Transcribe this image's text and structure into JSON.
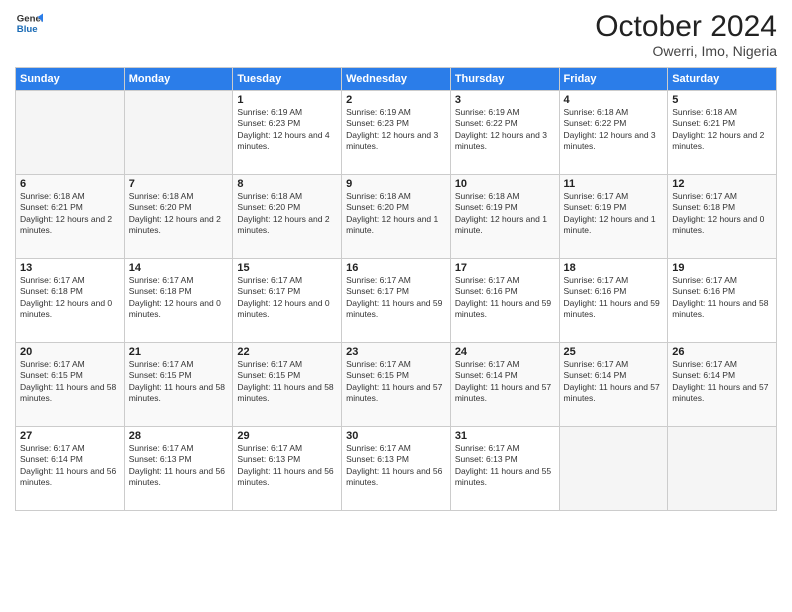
{
  "logo": {
    "line1": "General",
    "line2": "Blue"
  },
  "title": "October 2024",
  "location": "Owerri, Imo, Nigeria",
  "days_of_week": [
    "Sunday",
    "Monday",
    "Tuesday",
    "Wednesday",
    "Thursday",
    "Friday",
    "Saturday"
  ],
  "weeks": [
    [
      {
        "day": "",
        "info": ""
      },
      {
        "day": "",
        "info": ""
      },
      {
        "day": "1",
        "info": "Sunrise: 6:19 AM\nSunset: 6:23 PM\nDaylight: 12 hours and 4 minutes."
      },
      {
        "day": "2",
        "info": "Sunrise: 6:19 AM\nSunset: 6:23 PM\nDaylight: 12 hours and 3 minutes."
      },
      {
        "day": "3",
        "info": "Sunrise: 6:19 AM\nSunset: 6:22 PM\nDaylight: 12 hours and 3 minutes."
      },
      {
        "day": "4",
        "info": "Sunrise: 6:18 AM\nSunset: 6:22 PM\nDaylight: 12 hours and 3 minutes."
      },
      {
        "day": "5",
        "info": "Sunrise: 6:18 AM\nSunset: 6:21 PM\nDaylight: 12 hours and 2 minutes."
      }
    ],
    [
      {
        "day": "6",
        "info": "Sunrise: 6:18 AM\nSunset: 6:21 PM\nDaylight: 12 hours and 2 minutes."
      },
      {
        "day": "7",
        "info": "Sunrise: 6:18 AM\nSunset: 6:20 PM\nDaylight: 12 hours and 2 minutes."
      },
      {
        "day": "8",
        "info": "Sunrise: 6:18 AM\nSunset: 6:20 PM\nDaylight: 12 hours and 2 minutes."
      },
      {
        "day": "9",
        "info": "Sunrise: 6:18 AM\nSunset: 6:20 PM\nDaylight: 12 hours and 1 minute."
      },
      {
        "day": "10",
        "info": "Sunrise: 6:18 AM\nSunset: 6:19 PM\nDaylight: 12 hours and 1 minute."
      },
      {
        "day": "11",
        "info": "Sunrise: 6:17 AM\nSunset: 6:19 PM\nDaylight: 12 hours and 1 minute."
      },
      {
        "day": "12",
        "info": "Sunrise: 6:17 AM\nSunset: 6:18 PM\nDaylight: 12 hours and 0 minutes."
      }
    ],
    [
      {
        "day": "13",
        "info": "Sunrise: 6:17 AM\nSunset: 6:18 PM\nDaylight: 12 hours and 0 minutes."
      },
      {
        "day": "14",
        "info": "Sunrise: 6:17 AM\nSunset: 6:18 PM\nDaylight: 12 hours and 0 minutes."
      },
      {
        "day": "15",
        "info": "Sunrise: 6:17 AM\nSunset: 6:17 PM\nDaylight: 12 hours and 0 minutes."
      },
      {
        "day": "16",
        "info": "Sunrise: 6:17 AM\nSunset: 6:17 PM\nDaylight: 11 hours and 59 minutes."
      },
      {
        "day": "17",
        "info": "Sunrise: 6:17 AM\nSunset: 6:16 PM\nDaylight: 11 hours and 59 minutes."
      },
      {
        "day": "18",
        "info": "Sunrise: 6:17 AM\nSunset: 6:16 PM\nDaylight: 11 hours and 59 minutes."
      },
      {
        "day": "19",
        "info": "Sunrise: 6:17 AM\nSunset: 6:16 PM\nDaylight: 11 hours and 58 minutes."
      }
    ],
    [
      {
        "day": "20",
        "info": "Sunrise: 6:17 AM\nSunset: 6:15 PM\nDaylight: 11 hours and 58 minutes."
      },
      {
        "day": "21",
        "info": "Sunrise: 6:17 AM\nSunset: 6:15 PM\nDaylight: 11 hours and 58 minutes."
      },
      {
        "day": "22",
        "info": "Sunrise: 6:17 AM\nSunset: 6:15 PM\nDaylight: 11 hours and 58 minutes."
      },
      {
        "day": "23",
        "info": "Sunrise: 6:17 AM\nSunset: 6:15 PM\nDaylight: 11 hours and 57 minutes."
      },
      {
        "day": "24",
        "info": "Sunrise: 6:17 AM\nSunset: 6:14 PM\nDaylight: 11 hours and 57 minutes."
      },
      {
        "day": "25",
        "info": "Sunrise: 6:17 AM\nSunset: 6:14 PM\nDaylight: 11 hours and 57 minutes."
      },
      {
        "day": "26",
        "info": "Sunrise: 6:17 AM\nSunset: 6:14 PM\nDaylight: 11 hours and 57 minutes."
      }
    ],
    [
      {
        "day": "27",
        "info": "Sunrise: 6:17 AM\nSunset: 6:14 PM\nDaylight: 11 hours and 56 minutes."
      },
      {
        "day": "28",
        "info": "Sunrise: 6:17 AM\nSunset: 6:13 PM\nDaylight: 11 hours and 56 minutes."
      },
      {
        "day": "29",
        "info": "Sunrise: 6:17 AM\nSunset: 6:13 PM\nDaylight: 11 hours and 56 minutes."
      },
      {
        "day": "30",
        "info": "Sunrise: 6:17 AM\nSunset: 6:13 PM\nDaylight: 11 hours and 56 minutes."
      },
      {
        "day": "31",
        "info": "Sunrise: 6:17 AM\nSunset: 6:13 PM\nDaylight: 11 hours and 55 minutes."
      },
      {
        "day": "",
        "info": ""
      },
      {
        "day": "",
        "info": ""
      }
    ]
  ]
}
